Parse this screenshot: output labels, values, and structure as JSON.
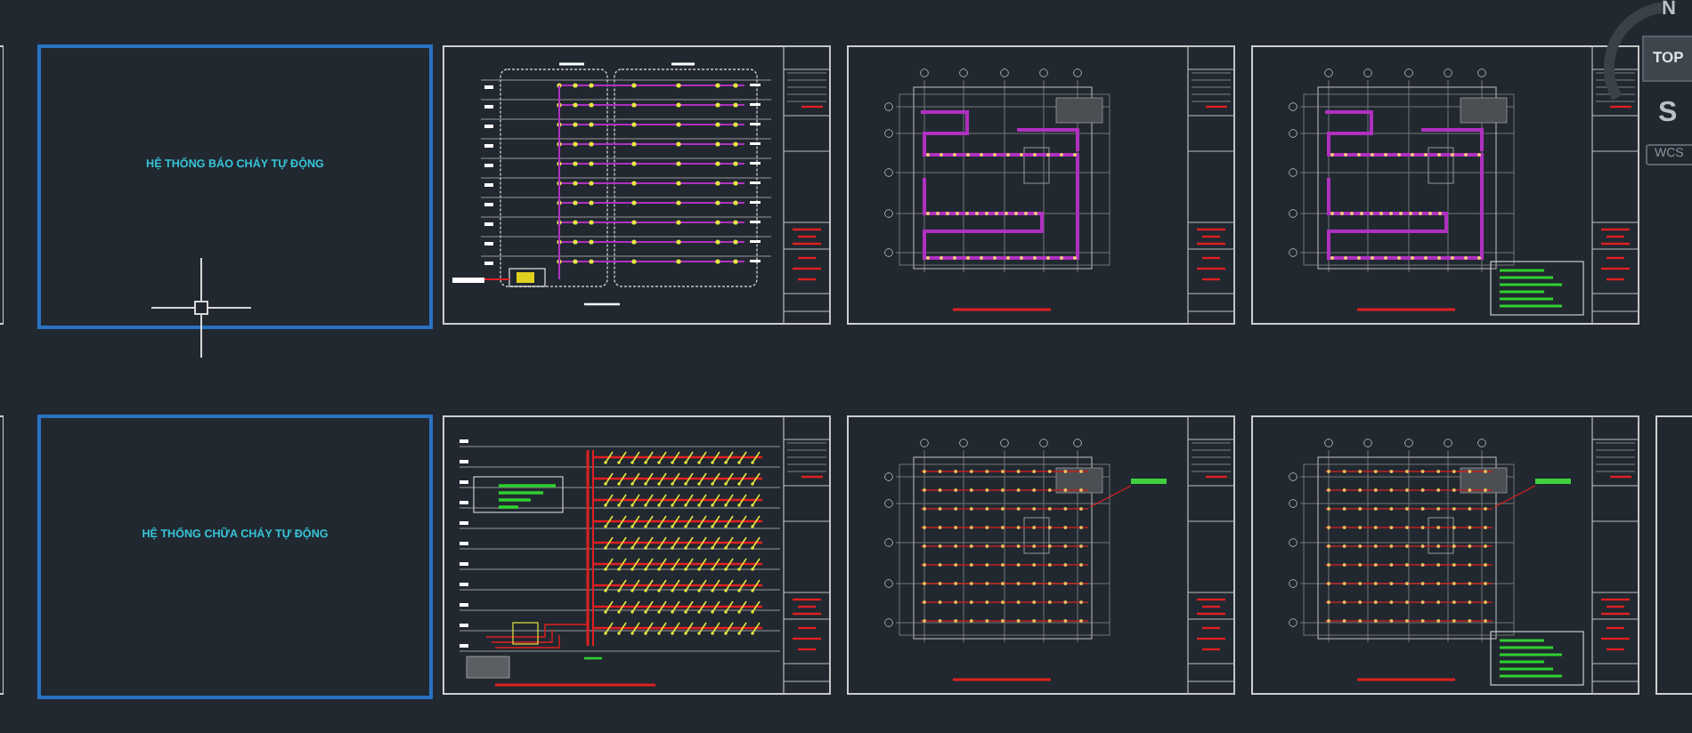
{
  "layout_rows": [
    {
      "title_sheet": {
        "title": "HỆ THỐNG BÁO CHÁY TỰ ĐỘNG"
      },
      "sheets": [
        {
          "kind": "alarm-riser"
        },
        {
          "kind": "alarm-plan",
          "legend": false
        },
        {
          "kind": "alarm-plan",
          "legend": true
        }
      ]
    },
    {
      "title_sheet": {
        "title": "HỆ THỐNG CHỮA CHÁY TỰ ĐỘNG"
      },
      "sheets": [
        {
          "kind": "sprinkler-riser"
        },
        {
          "kind": "sprinkler-plan",
          "legend": false
        },
        {
          "kind": "sprinkler-plan",
          "legend": true
        }
      ]
    }
  ],
  "view_cube": {
    "north": "N",
    "face": "TOP",
    "south": "S",
    "coordinate_system": "WCS"
  }
}
